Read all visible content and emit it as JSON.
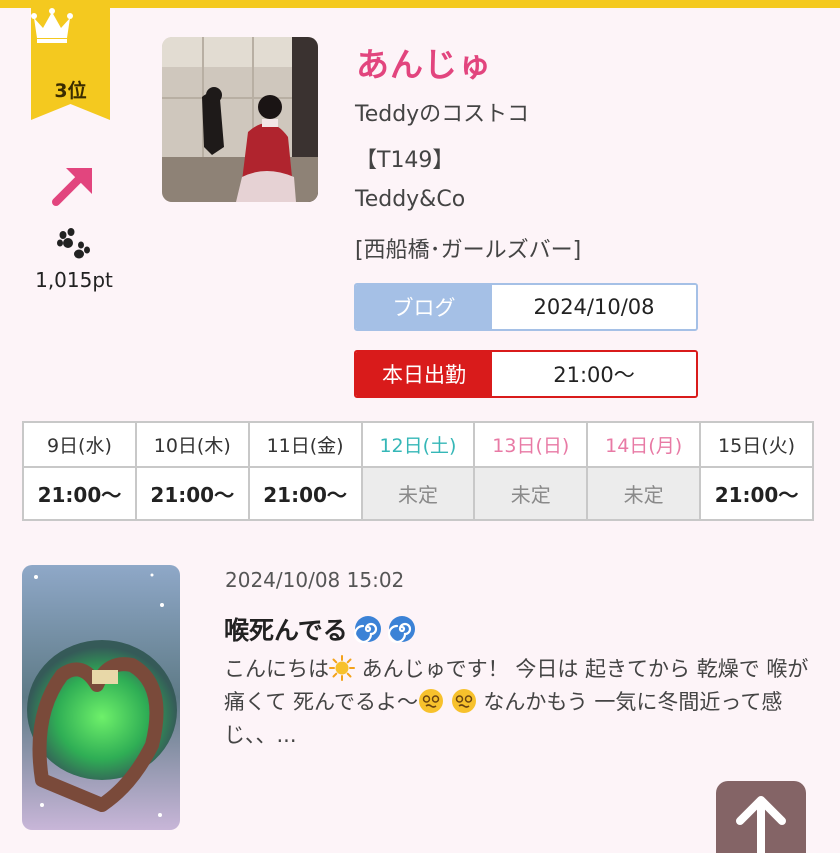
{
  "rank": {
    "label": "3位"
  },
  "trend_icon": "arrow-up-right-icon",
  "points": "1,015pt",
  "cast": {
    "name": "あんじゅ",
    "event": "Teddyのコストコ",
    "height": "【T149】",
    "shop": "Teddy&Co",
    "area": "[西船橋･ガールズバー]"
  },
  "blog": {
    "label": "ブログ",
    "date": "2024/10/08"
  },
  "today": {
    "label": "本日出勤",
    "time": "21:00〜"
  },
  "schedule": [
    {
      "day": "9日(水)",
      "time": "21:00〜",
      "kind": "weekday"
    },
    {
      "day": "10日(木)",
      "time": "21:00〜",
      "kind": "weekday"
    },
    {
      "day": "11日(金)",
      "time": "21:00〜",
      "kind": "weekday"
    },
    {
      "day": "12日(土)",
      "time": "未定",
      "kind": "sat"
    },
    {
      "day": "13日(日)",
      "time": "未定",
      "kind": "sun"
    },
    {
      "day": "14日(月)",
      "time": "未定",
      "kind": "sun"
    },
    {
      "day": "15日(火)",
      "time": "21:00〜",
      "kind": "weekday"
    }
  ],
  "post": {
    "datetime": "2024/10/08 15:02",
    "title": "喉死んでる",
    "title_icons": [
      "cyclone-icon",
      "cyclone-icon"
    ],
    "body_1": "こんにちは",
    "body_2": " あんじゅです！ 今日は 起きてから 乾燥で 喉が痛くて 死んでるよ〜",
    "body_3": " なんかもう 一気に冬間近って感じ、、..."
  },
  "colors": {
    "accent_pink": "#e2457e",
    "badge_gold": "#f4c91f",
    "blog_blue": "#a5c0e6",
    "work_red": "#d91b1b",
    "saturday": "#35b7b7",
    "sunday": "#e87aa5",
    "scroll_button": "#846466"
  }
}
